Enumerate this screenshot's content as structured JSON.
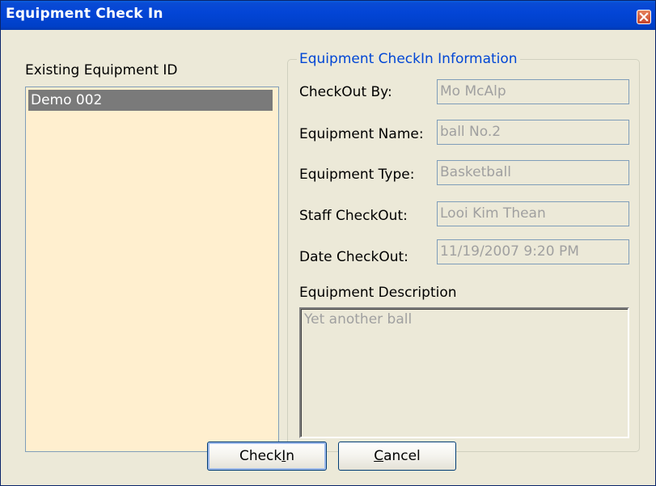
{
  "window": {
    "title": "Equipment Check In",
    "close_icon": "close-icon"
  },
  "left": {
    "label": "Existing Equipment ID",
    "items": [
      {
        "label": "Demo 002",
        "selected": true
      }
    ]
  },
  "info": {
    "group_title": "Equipment CheckIn Information",
    "fields": [
      {
        "label": "CheckOut By:",
        "value": "Mo McAlp"
      },
      {
        "label": "Equipment Name:",
        "value": "ball No.2"
      },
      {
        "label": "Equipment Type:",
        "value": "Basketball"
      },
      {
        "label": "Staff CheckOut:",
        "value": "Looi Kim Thean"
      },
      {
        "label": "Date CheckOut:",
        "value": "11/19/2007 9:20 PM"
      }
    ],
    "description_label": "Equipment Description",
    "description_value": "Yet another ball"
  },
  "buttons": {
    "checkin_pre": "Check",
    "checkin_mnemonic": "I",
    "checkin_post": "n",
    "cancel_mnemonic": "C",
    "cancel_post": "ancel"
  },
  "colors": {
    "titlebar": "#0345D6",
    "dialog_bg": "#ECE9D8",
    "listbox_bg": "#FFEFCF",
    "group_title": "#0046D5",
    "selected_item": "#7A7A7A",
    "disabled_text": "#A0A0A0"
  }
}
